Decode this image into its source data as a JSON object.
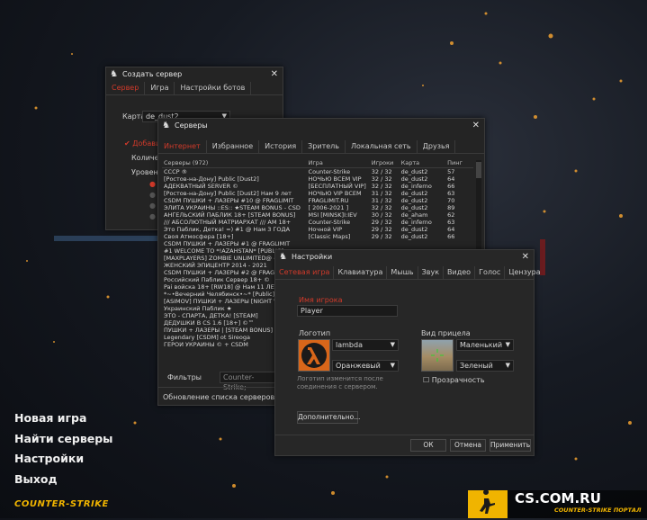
{
  "main_menu": {
    "new_game": "Новая игра",
    "find_servers": "Найти серверы",
    "settings": "Настройки",
    "exit": "Выход"
  },
  "brand": {
    "logo_text": "COUNTER-STRIKE",
    "site": "CS.COM.RU",
    "site_sub": "COUNTER-STRIKE ПОРТАЛ",
    "accent": "#f0b400"
  },
  "create_server": {
    "title": "Создать сервер",
    "tabs": [
      "Сервер",
      "Игра",
      "Настройки ботов"
    ],
    "map_label": "Карта",
    "map_value": "de_dust2",
    "add_bots_label": "Добавит",
    "count_label": "Количес",
    "level_label": "Уровень"
  },
  "servers": {
    "title": "Серверы",
    "tabs": [
      "Интернет",
      "Избранное",
      "История",
      "Зритель",
      "Локальная сеть",
      "Друзья"
    ],
    "columns": [
      "Серверы (972)",
      "Игра",
      "Игроки",
      "Карта",
      "Пинг"
    ],
    "rows": [
      [
        "CCCP ®",
        "Counter-Strike",
        "32 / 32",
        "de_dust2",
        "57"
      ],
      [
        "[Ростов-на-Дону] Public [Dust2]",
        "НОЧЬЮ ВСЕМ VIP",
        "32 / 32",
        "de_dust2",
        "64"
      ],
      [
        "АДЕКВАТНЫЙ SERVER ©",
        "[БЕСПЛАТНЫЙ VIP]",
        "32 / 32",
        "de_inferno",
        "66"
      ],
      [
        "[Ростов-на-Дону] Public [Dust2] Нам 9 лет",
        "НОЧЬЮ VIP ВСЕМ",
        "31 / 32",
        "de_dust2",
        "63"
      ],
      [
        "CSDM ПУШКИ + ЛАЗЕРЫ #10 @ FRAGLIMIT",
        "FRAGLIMIT.RU",
        "31 / 32",
        "de_dust2",
        "70"
      ],
      [
        "ЭЛИТА УКРАИНЫ ::ES:: ★STEAM BONUS - CSD",
        "[ 2006-2021 ]",
        "32 / 32",
        "de_dust2",
        "89"
      ],
      [
        "АНГЕЛЬСКИЙ ПАБЛИК 18+ [STEAM BONUS]",
        "MSI [MINSK]I:IEV",
        "30 / 32",
        "de_aham",
        "62"
      ],
      [
        "/// АБСОЛЮТНЫЙ МАТРИАРХАТ /// AM 18+",
        "Counter-Strike",
        "29 / 32",
        "de_inferno",
        "63"
      ],
      [
        "Это Паблик, Детка! =) #1 @ Нам 3 ГОДА",
        "Ночной VIP",
        "29 / 32",
        "de_dust2",
        "64"
      ],
      [
        "Своя Атмосфера [18+]",
        "[Classic Maps]",
        "29 / 32",
        "de_dust2",
        "66"
      ],
      [
        "CSDM ПУШКИ + ЛАЗЕРЫ #1 @ FRAGLIMIT",
        "",
        "",
        "",
        ""
      ],
      [
        "#1 WELCOME TO *!AZAHSTAN* [PUBLIC]",
        "",
        "",
        "",
        ""
      ],
      [
        "[MAXPLAYERS] ZOMBIE UNLIMITED@ #1",
        "",
        "",
        "",
        ""
      ],
      [
        "ЖЕНСКИЙ ЭПИЦЕНТР 2014 - 2021",
        "",
        "",
        "",
        ""
      ],
      [
        "CSDM ПУШКИ + ЛАЗЕРЫ #2 @ FRAGLIMIT",
        "",
        "",
        "",
        ""
      ],
      [
        "Российский Паблик Сервер 18+ ©",
        "",
        "",
        "",
        ""
      ],
      [
        "Pai войска 18+ [RW18] @ Нам 11 ЛЕТ!",
        "",
        "",
        "",
        ""
      ],
      [
        "*~•Вечерний Челябинск•~* [Public]",
        "",
        "",
        "",
        ""
      ],
      [
        "[ASIMOV] ПУШКИ + ЛАЗЕРЫ [NIGHT VIP]",
        "",
        "",
        "",
        ""
      ],
      [
        "Украинский Паблик ★",
        "",
        "",
        "",
        ""
      ],
      [
        "ЭТО - СПАРТА, ДЕТКА! [STEAM]",
        "",
        "",
        "",
        ""
      ],
      [
        "ДЕДУШКИ В CS 1.6 [18+] ©™",
        "",
        "",
        "",
        ""
      ],
      [
        "ПУШКИ + ЛАЗЕРЫ | [STEAM BONUS]",
        "",
        "",
        "",
        ""
      ],
      [
        "Legendary [CSDM] ot Sireoga",
        "",
        "",
        "",
        ""
      ],
      [
        "ГЕРОИ УКРАИНЫ © + CSDM",
        "",
        "",
        "",
        ""
      ]
    ],
    "filters_label": "Фильтры",
    "filters_value": "Counter-Strike;",
    "status": "Обновление списка серверов..."
  },
  "settings": {
    "title": "Настройки",
    "tabs": [
      "Сетевая игра",
      "Клавиатура",
      "Мышь",
      "Звук",
      "Видео",
      "Голос",
      "Цензура"
    ],
    "name_label": "Имя игрока",
    "name_value": "Player",
    "logo_label": "Логотип",
    "logo_name": "lambda",
    "logo_color": "Оранжевый",
    "logo_note": "Логотип изменится после соединения с сервером.",
    "crosshair_label": "Вид прицела",
    "crosshair_size": "Маленький",
    "crosshair_color": "Зеленый",
    "transparency_label": "Прозрачность",
    "advanced_button": "Дополнительно...",
    "ok_button": "ОК",
    "cancel_button": "Отмена",
    "apply_button": "Применить"
  }
}
